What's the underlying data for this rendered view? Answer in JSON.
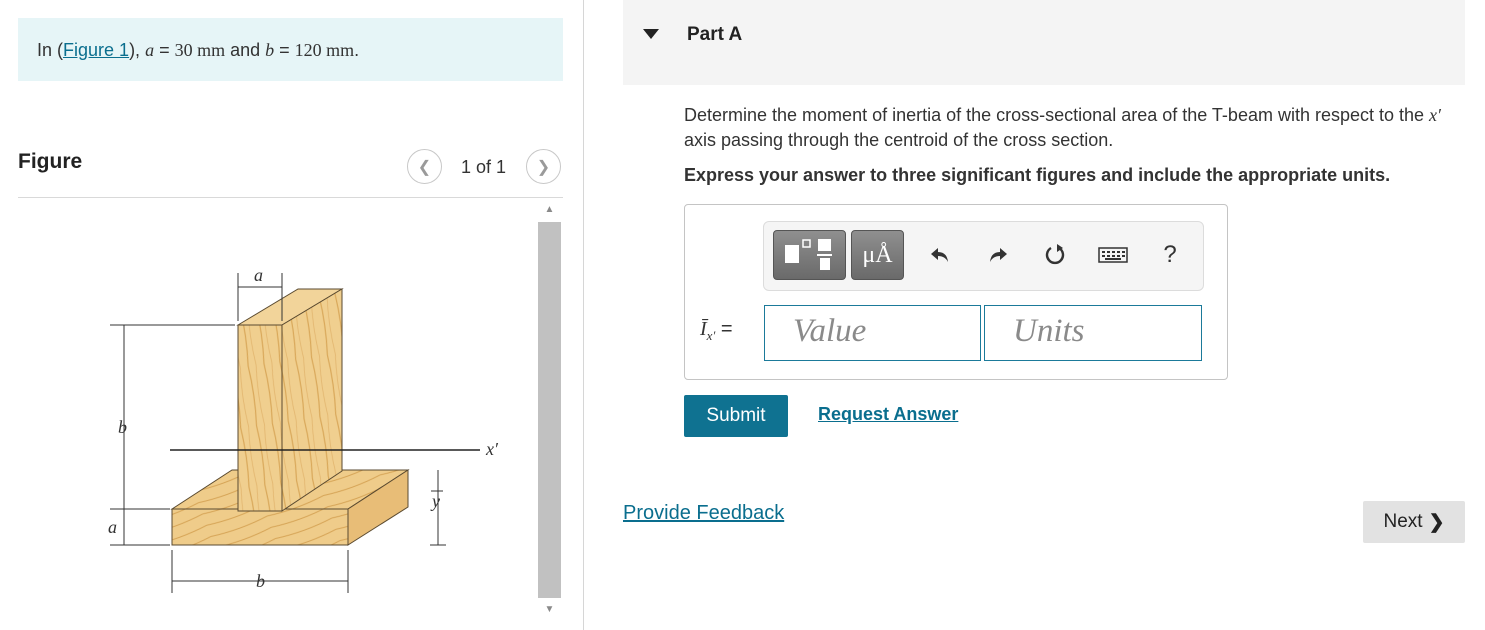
{
  "intro": {
    "prefix": "In (",
    "figure_link": "Figure 1",
    "middle": "), ",
    "a_var": "a",
    "eq1": " = ",
    "a_value": "30 mm",
    "and": " and ",
    "b_var": "b",
    "eq2": " = ",
    "b_value": "120 mm",
    "suffix": "."
  },
  "figure": {
    "title": "Figure",
    "counter": "1 of 1",
    "labels": {
      "a_top": "a",
      "b_left": "b",
      "a_left": "a",
      "b_bottom": "b",
      "x_axis": "x′",
      "y_bar": "y"
    }
  },
  "part": {
    "title": "Part A"
  },
  "question": {
    "line_pre": "Determine the moment of inertia of the cross-sectional area of the T-beam with respect to the ",
    "axis": "x′",
    "line_post": " axis passing through the centroid of the cross section.",
    "instruction": "Express your answer to three significant figures and include the appropriate units."
  },
  "answer": {
    "label_symbol": "Ī",
    "label_sub": "x′",
    "label_eq": "=",
    "value_placeholder": "Value",
    "units_placeholder": "Units",
    "toolbar": {
      "units_btn": "μÅ",
      "help": "?",
      "icons": [
        "templates-icon",
        "units-icon",
        "undo-icon",
        "redo-icon",
        "reset-icon",
        "keyboard-icon",
        "help-icon"
      ]
    }
  },
  "actions": {
    "submit": "Submit",
    "request_answer": "Request Answer",
    "feedback": "Provide Feedback",
    "next": "Next"
  },
  "colors": {
    "accent": "#0f7291",
    "link": "#0a6e8e",
    "intro_bg": "#e6f5f7"
  }
}
